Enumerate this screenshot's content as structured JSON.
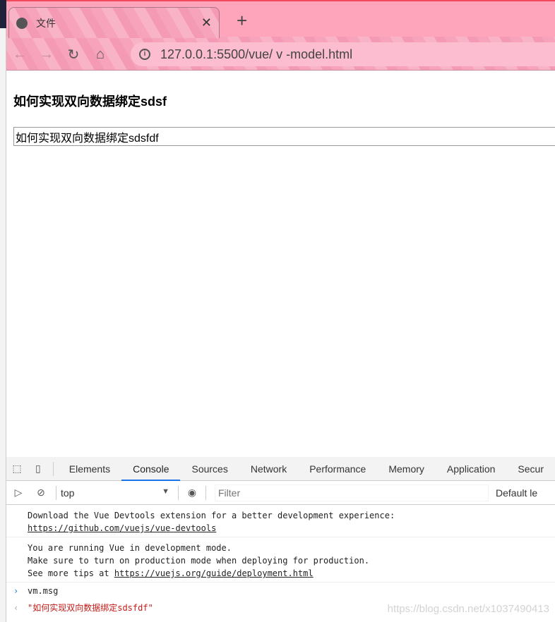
{
  "browser": {
    "tab_title": "文件",
    "url": "127.0.0.1:5500/vue/ v -model.html"
  },
  "page": {
    "heading": "如何实现双向数据绑定sdsf",
    "input_value": "如何实现双向数据绑定sdsfdf"
  },
  "devtools": {
    "tabs": [
      "Elements",
      "Console",
      "Sources",
      "Network",
      "Performance",
      "Memory",
      "Application",
      "Secur"
    ],
    "active_tab": "Console",
    "context": "top",
    "filter_placeholder": "Filter",
    "levels": "Default le",
    "messages": [
      {
        "text": "Download the Vue Devtools extension for a better development experience:",
        "link": "https://github.com/vuejs/vue-devtools"
      },
      {
        "line1": "You are running Vue in development mode.",
        "line2": "Make sure to turn on production mode when deploying for production.",
        "line3": "See more tips at ",
        "link": "https://vuejs.org/guide/deployment.html"
      }
    ],
    "input": "vm.msg",
    "result": "\"如何实现双向数据绑定sdsfdf\""
  },
  "watermark": "https://blog.csdn.net/x1037490413"
}
